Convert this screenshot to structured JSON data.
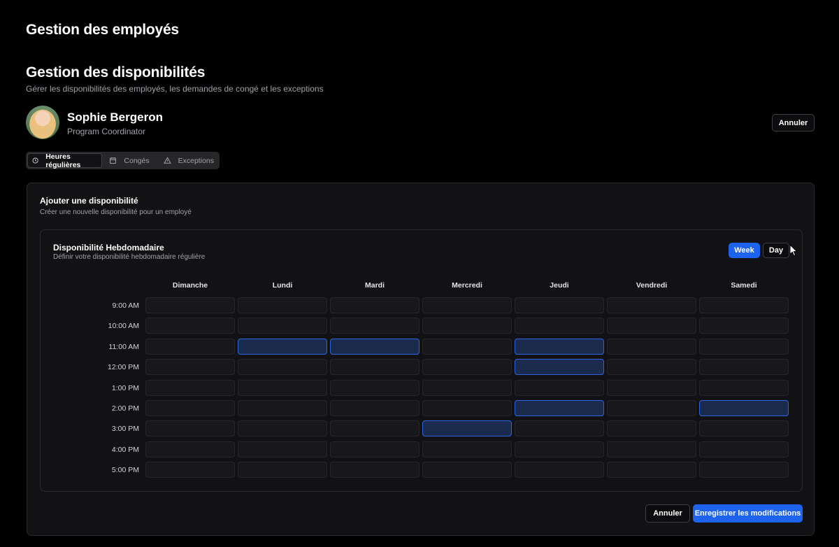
{
  "app": {
    "title": "Gestion des employés"
  },
  "section": {
    "title": "Gestion des disponibilités",
    "subtitle": "Gérer les disponibilités des employés, les demandes de congé et les exceptions"
  },
  "employee": {
    "name": "Sophie Bergeron",
    "role": "Program Coordinator",
    "cancel_label": "Annuler"
  },
  "tabs": [
    {
      "label": "Heures régulières",
      "icon": "clock-icon",
      "active": true
    },
    {
      "label": "Congés",
      "icon": "calendar-icon",
      "active": false
    },
    {
      "label": "Exceptions",
      "icon": "warning-icon",
      "active": false
    }
  ],
  "card": {
    "title": "Ajouter une disponibilité",
    "subtitle": "Créer une nouvelle disponibilité pour un employé"
  },
  "weekly": {
    "title": "Disponibilité Hebdomadaire",
    "subtitle": "Définir votre disponibilité hebdomadaire régulière",
    "view_week": "Week",
    "view_day": "Day",
    "days": [
      "Dimanche",
      "Lundi",
      "Mardi",
      "Mercredi",
      "Jeudi",
      "Vendredi",
      "Samedi"
    ],
    "times": [
      "9:00 AM",
      "10:00 AM",
      "11:00 AM",
      "12:00 PM",
      "1:00 PM",
      "2:00 PM",
      "3:00 PM",
      "4:00 PM",
      "5:00 PM"
    ],
    "selected": [
      [
        1,
        2
      ],
      [
        2,
        2
      ],
      [
        3,
        6
      ],
      [
        4,
        2
      ],
      [
        4,
        3
      ],
      [
        4,
        5
      ],
      [
        6,
        5
      ]
    ]
  },
  "footer": {
    "cancel_label": "Annuler",
    "save_label": "Enregistrer les modifications"
  },
  "colors": {
    "accent": "#1d63ed",
    "selected_cell": "#1a2b4d",
    "background": "#000000"
  }
}
